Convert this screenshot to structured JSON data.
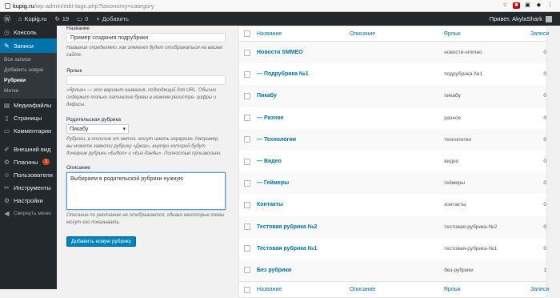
{
  "browser": {
    "url_host": "kupig.ru",
    "url_path": "/wp-admin/edit-tags.php?taxonomy=category"
  },
  "adminbar": {
    "site": "Kupig.ru",
    "updates": "19",
    "comments": "0",
    "add": "Добавить",
    "howdy": "Привет, AkylaShark"
  },
  "sidebar": {
    "items": [
      {
        "label": "Консоль",
        "icon": "dashboard-icon"
      },
      {
        "label": "Записи",
        "icon": "pin-icon"
      },
      {
        "label": "Медиафайлы",
        "icon": "media-icon"
      },
      {
        "label": "Страницы",
        "icon": "page-icon"
      },
      {
        "label": "Комментарии",
        "icon": "comment-icon"
      },
      {
        "label": "Внешний вид",
        "icon": "brush-icon"
      },
      {
        "label": "Плагины",
        "icon": "plugin-icon",
        "badge": "1"
      },
      {
        "label": "Пользователи",
        "icon": "users-icon"
      },
      {
        "label": "Инструменты",
        "icon": "tools-icon"
      },
      {
        "label": "Настройки",
        "icon": "settings-icon"
      },
      {
        "label": "Свернуть меню",
        "icon": "collapse-icon"
      }
    ],
    "submenu": [
      "Все записи",
      "Добавить новую",
      "Рубрики",
      "Метки"
    ]
  },
  "form": {
    "name_label": "Название",
    "name_value": "Пример создания подрубрики",
    "name_help": "Название определяет, как элемент будет отображаться на вашем сайте.",
    "slug_label": "Ярлык",
    "slug_value": "",
    "slug_help": "«Ярлык» — это вариант названия, подходящий для URL. Обычно содержит только латинские буквы в нижнем регистре, цифры и дефисы.",
    "parent_label": "Родительская рубрика",
    "parent_value": "Пикабу",
    "parent_help": "Рубрики, в отличие от меток, могут иметь иерархию. Например, вы можете завести рубрику «Джаз», внутри которой будут дочерние рубрики «Бибоп» и «Биг-бэнды». Полностью произвольно.",
    "desc_label": "Описание",
    "desc_value": "Выбираем в родительской рубрики нужную",
    "desc_help": "Описание по умолчанию не отображается, однако некоторые темы могут его показывать.",
    "submit": "Добавить новую рубрику"
  },
  "table": {
    "headers": {
      "name": "Название",
      "desc": "Описание",
      "slug": "Ярлык",
      "count": "Записи"
    },
    "rows": [
      {
        "name": "Новости SMMEO",
        "slug": "новости-smmeo",
        "count": "0"
      },
      {
        "name": "— Подрубрика №1",
        "slug": "подрубрика-№1",
        "count": "0"
      },
      {
        "name": "Пикабу",
        "slug": "пикабу",
        "count": "0"
      },
      {
        "name": "— Разное",
        "slug": "разное",
        "count": "0"
      },
      {
        "name": "— Технологии",
        "slug": "технологии",
        "count": "0"
      },
      {
        "name": "— Видео",
        "slug": "видео",
        "count": "0"
      },
      {
        "name": "— Геймеры",
        "slug": "геймеры",
        "count": "0"
      },
      {
        "name": "Контакты",
        "slug": "контакты",
        "count": "0"
      },
      {
        "name": "Тестовая рубрика №2",
        "slug": "тестовая-рубрика-№2",
        "count": "0"
      },
      {
        "name": "Тестовая рубрика №1",
        "slug": "тестовая-рубрика-№1",
        "count": "0"
      },
      {
        "name": "Без рубрики",
        "slug": "без-рубрики",
        "count": "1"
      }
    ]
  }
}
